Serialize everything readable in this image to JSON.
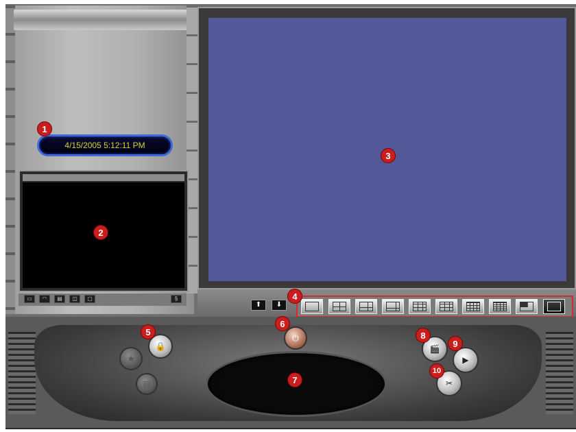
{
  "datetime": "4/15/2005 5:12:11 PM",
  "markers": [
    "1",
    "2",
    "3",
    "4",
    "5",
    "6",
    "7",
    "8",
    "9",
    "10"
  ],
  "nav": {
    "up_label": "⬆",
    "down_label": "⬇"
  },
  "preview_toolbar_icons": [
    "camera-icon",
    "tag-icon",
    "tape-icon",
    "window-icon",
    "folder-icon",
    "settings-icon"
  ],
  "layout_buttons": [
    "single-view",
    "quad-view",
    "view-6",
    "view-8",
    "view-9",
    "view-10",
    "view-13",
    "view-16",
    "pip-view",
    "fullscreen-view"
  ],
  "console_buttons": {
    "lock": "🔒",
    "power": "⏻",
    "record": "🎬",
    "play": "▶",
    "tools": "✂"
  },
  "colors": {
    "marker": "#c81e1e",
    "main_screen": "#525898",
    "datetime_text": "#d6d23a",
    "layout_bar_border": "#d72a2a"
  }
}
